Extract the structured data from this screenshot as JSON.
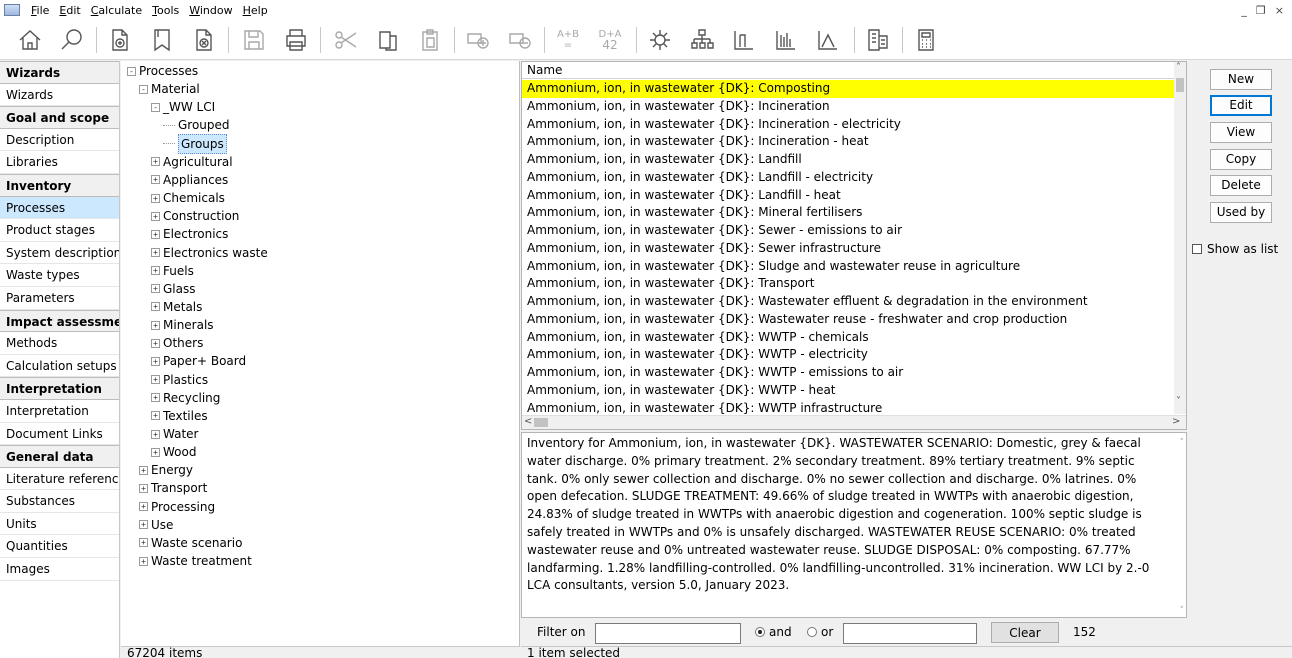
{
  "menu": [
    "File",
    "Edit",
    "Calculate",
    "Tools",
    "Window",
    "Help"
  ],
  "window_controls": [
    "_",
    "̅",
    "×"
  ],
  "toolbar": {
    "sum_label": "A+B",
    "sum_sub": "=",
    "d_label": "D+A",
    "d_sub": "42"
  },
  "nav": [
    {
      "label": "Wizards",
      "type": "header"
    },
    {
      "label": "Wizards",
      "type": "item"
    },
    {
      "label": "Goal and scope",
      "type": "header"
    },
    {
      "label": "Description",
      "type": "item"
    },
    {
      "label": "Libraries",
      "type": "item"
    },
    {
      "label": "Inventory",
      "type": "header"
    },
    {
      "label": "Processes",
      "type": "active"
    },
    {
      "label": "Product stages",
      "type": "item"
    },
    {
      "label": "System description",
      "type": "item"
    },
    {
      "label": "Waste types",
      "type": "item"
    },
    {
      "label": "Parameters",
      "type": "item"
    },
    {
      "label": "Impact assessmer",
      "type": "header"
    },
    {
      "label": "Methods",
      "type": "item"
    },
    {
      "label": "Calculation setups",
      "type": "item"
    },
    {
      "label": "Interpretation",
      "type": "header"
    },
    {
      "label": "Interpretation",
      "type": "item"
    },
    {
      "label": "Document Links",
      "type": "item"
    },
    {
      "label": "General data",
      "type": "header"
    },
    {
      "label": "Literature reference",
      "type": "item"
    },
    {
      "label": "Substances",
      "type": "item"
    },
    {
      "label": "Units",
      "type": "item"
    },
    {
      "label": "Quantities",
      "type": "item"
    },
    {
      "label": "Images",
      "type": "item"
    }
  ],
  "tree": [
    {
      "label": "Processes",
      "level": 0,
      "expander": "-"
    },
    {
      "label": "Material",
      "level": 1,
      "expander": "-"
    },
    {
      "label": "_WW LCI",
      "level": 2,
      "expander": "-"
    },
    {
      "label": "Grouped",
      "level": 3,
      "expander": "leaf"
    },
    {
      "label": "Groups",
      "level": 3,
      "expander": "leaf",
      "selected": true
    },
    {
      "label": "Agricultural",
      "level": 2,
      "expander": "+"
    },
    {
      "label": "Appliances",
      "level": 2,
      "expander": "+"
    },
    {
      "label": "Chemicals",
      "level": 2,
      "expander": "+"
    },
    {
      "label": "Construction",
      "level": 2,
      "expander": "+"
    },
    {
      "label": "Electronics",
      "level": 2,
      "expander": "+"
    },
    {
      "label": "Electronics waste",
      "level": 2,
      "expander": "+"
    },
    {
      "label": "Fuels",
      "level": 2,
      "expander": "+"
    },
    {
      "label": "Glass",
      "level": 2,
      "expander": "+"
    },
    {
      "label": "Metals",
      "level": 2,
      "expander": "+"
    },
    {
      "label": "Minerals",
      "level": 2,
      "expander": "+"
    },
    {
      "label": "Others",
      "level": 2,
      "expander": "+"
    },
    {
      "label": "Paper+ Board",
      "level": 2,
      "expander": "+"
    },
    {
      "label": "Plastics",
      "level": 2,
      "expander": "+"
    },
    {
      "label": "Recycling",
      "level": 2,
      "expander": "+"
    },
    {
      "label": "Textiles",
      "level": 2,
      "expander": "+"
    },
    {
      "label": "Water",
      "level": 2,
      "expander": "+"
    },
    {
      "label": "Wood",
      "level": 2,
      "expander": "+"
    },
    {
      "label": "Energy",
      "level": 1,
      "expander": "+"
    },
    {
      "label": "Transport",
      "level": 1,
      "expander": "+"
    },
    {
      "label": "Processing",
      "level": 1,
      "expander": "+"
    },
    {
      "label": "Use",
      "level": 1,
      "expander": "+"
    },
    {
      "label": "Waste scenario",
      "level": 1,
      "expander": "+"
    },
    {
      "label": "Waste treatment",
      "level": 1,
      "expander": "+"
    }
  ],
  "list": {
    "header": "Name",
    "rows": [
      "Ammonium, ion, in wastewater {DK}: Composting",
      "Ammonium, ion, in wastewater {DK}: Incineration",
      "Ammonium, ion, in wastewater {DK}: Incineration - electricity",
      "Ammonium, ion, in wastewater {DK}: Incineration - heat",
      "Ammonium, ion, in wastewater {DK}: Landfill",
      "Ammonium, ion, in wastewater {DK}: Landfill - electricity",
      "Ammonium, ion, in wastewater {DK}: Landfill - heat",
      "Ammonium, ion, in wastewater {DK}: Mineral fertilisers",
      "Ammonium, ion, in wastewater {DK}: Sewer - emissions to air",
      "Ammonium, ion, in wastewater {DK}: Sewer infrastructure",
      "Ammonium, ion, in wastewater {DK}: Sludge and wastewater reuse in agriculture",
      "Ammonium, ion, in wastewater {DK}: Transport",
      "Ammonium, ion, in wastewater {DK}: Wastewater effluent & degradation in the environment",
      "Ammonium, ion, in wastewater {DK}: Wastewater reuse - freshwater and crop production",
      "Ammonium, ion, in wastewater {DK}: WWTP - chemicals",
      "Ammonium, ion, in wastewater {DK}: WWTP - electricity",
      "Ammonium, ion, in wastewater {DK}: WWTP - emissions to air",
      "Ammonium, ion, in wastewater {DK}: WWTP - heat",
      "Ammonium, ion, in wastewater {DK}: WWTP infrastructure"
    ],
    "selected_index": 0
  },
  "description": "Inventory for Ammonium, ion, in wastewater {DK}. WASTEWATER SCENARIO: Domestic, grey & faecal water discharge. 0% primary treatment. 2% secondary treatment. 89% tertiary treatment. 9% septic tank. 0% only sewer collection and discharge. 0% no sewer collection and discharge. 0% latrines. 0% open defecation. SLUDGE TREATMENT: 49.66% of sludge treated in WWTPs with anaerobic digestion, 24.83% of sludge treated in WWTPs with anaerobic digestion and cogeneration. 100% septic sludge is safely treated in WWTPs and 0% is unsafely discharged. WASTEWATER REUSE SCENARIO: 0% treated wastewater reuse and 0% untreated wastewater reuse. SLUDGE DISPOSAL: 0% composting. 67.77% landfarming. 1.28% landfilling-controlled. 0% landfilling-uncontrolled. 31% incineration. WW LCI by 2.-0 LCA consultants, version 5.0, January 2023.",
  "filter": {
    "label": "Filter on",
    "value1": "",
    "and_label": "and",
    "or_label": "or",
    "value2": "",
    "clear_label": "Clear",
    "count": "152",
    "mode": "and"
  },
  "buttons": {
    "new": "New",
    "edit": "Edit",
    "view": "View",
    "copy": "Copy",
    "delete": "Delete",
    "used_by": "Used by",
    "show_as_list": "Show as list"
  },
  "status": {
    "left": "67204 items",
    "right": "1 item selected"
  },
  "colors": {
    "selection_highlight": "#ffff00",
    "nav_active": "#cce8ff"
  }
}
